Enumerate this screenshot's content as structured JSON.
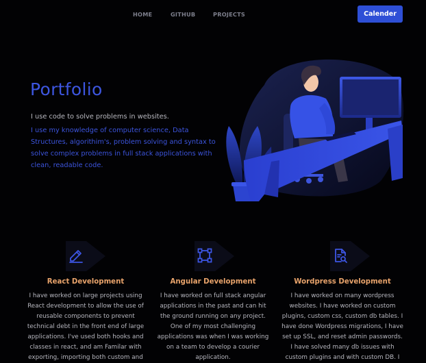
{
  "nav": {
    "home": "HOME",
    "github": "GITHUB",
    "projects": "PROJECTS",
    "calendar_button": "Calender"
  },
  "hero": {
    "title": "Portfolio",
    "intro": "I use code to solve problems in websites.",
    "body": "I use my knowledge of computer science, Data Structures, algorithim's, problem solving and syntax to solve complex problems in full stack applications with clean, readable code."
  },
  "colors": {
    "accent": "#2e4fd6",
    "service_title": "#e8a36b",
    "background": "#020204"
  },
  "services": [
    {
      "icon": "pencil-icon",
      "title": "React Development",
      "text": "I have worked on large projects using React development to allow the use of reusable components to prevent technical debt in the front end of large applications. I've used both hooks and classes in react, and am Familar with exporting, importing both custom and"
    },
    {
      "icon": "vector-square-icon",
      "title": "Angular Development",
      "text": "I have worked on full stack angular applications in the past and can hit the ground running on any project. One of my most challenging applications was when I was working on a team to develop a courier application."
    },
    {
      "icon": "file-search-icon",
      "title": "Wordpress Development",
      "text": "I have worked on many wordpress websites. I have worked on custom plugins, custom css, custom db tables. I have done Wordpress migrations, I have set up SSL, and reset admin passwords. I have solved many db issues with custom plugins and with custom DB. I have"
    }
  ]
}
